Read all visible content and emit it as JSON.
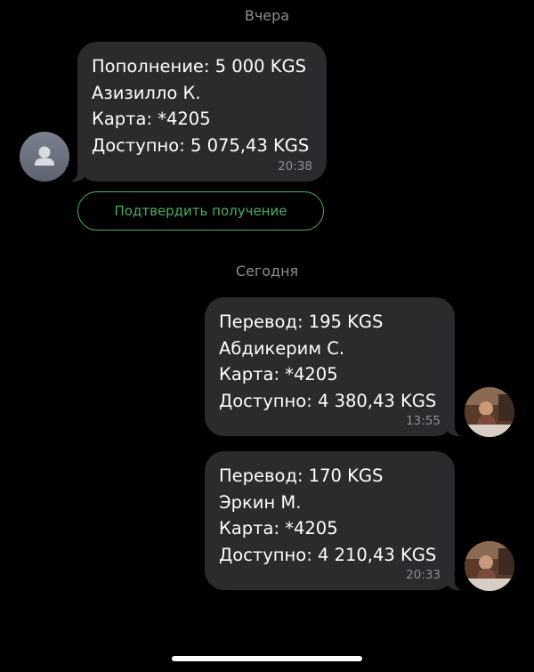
{
  "separators": {
    "yesterday": "Вчера",
    "today": "Сегодня"
  },
  "messages": [
    {
      "direction": "incoming",
      "lines": [
        "Пополнение: 5 000 KGS",
        "Азизилло К.",
        "Карта: *4205",
        "Доступно: 5 075,43 KGS"
      ],
      "time": "20:38"
    },
    {
      "direction": "outgoing",
      "lines": [
        "Перевод: 195 KGS",
        "Абдикерим С.",
        "Карта: *4205",
        "Доступно: 4 380,43 KGS"
      ],
      "time": "13:55"
    },
    {
      "direction": "outgoing",
      "lines": [
        "Перевод: 170 KGS",
        "Эркин М.",
        "Карта: *4205",
        "Доступно: 4 210,43 KGS"
      ],
      "time": "20:33"
    }
  ],
  "confirm_button": {
    "label": "Подтвердить получение"
  },
  "colors": {
    "background": "#000000",
    "bubble": "#2b2b2d",
    "accent_green": "#4cae61",
    "muted_text": "#8e8e93"
  },
  "icons": {
    "bot_avatar": "person-silhouette-icon",
    "user_avatar": "user-photo"
  }
}
